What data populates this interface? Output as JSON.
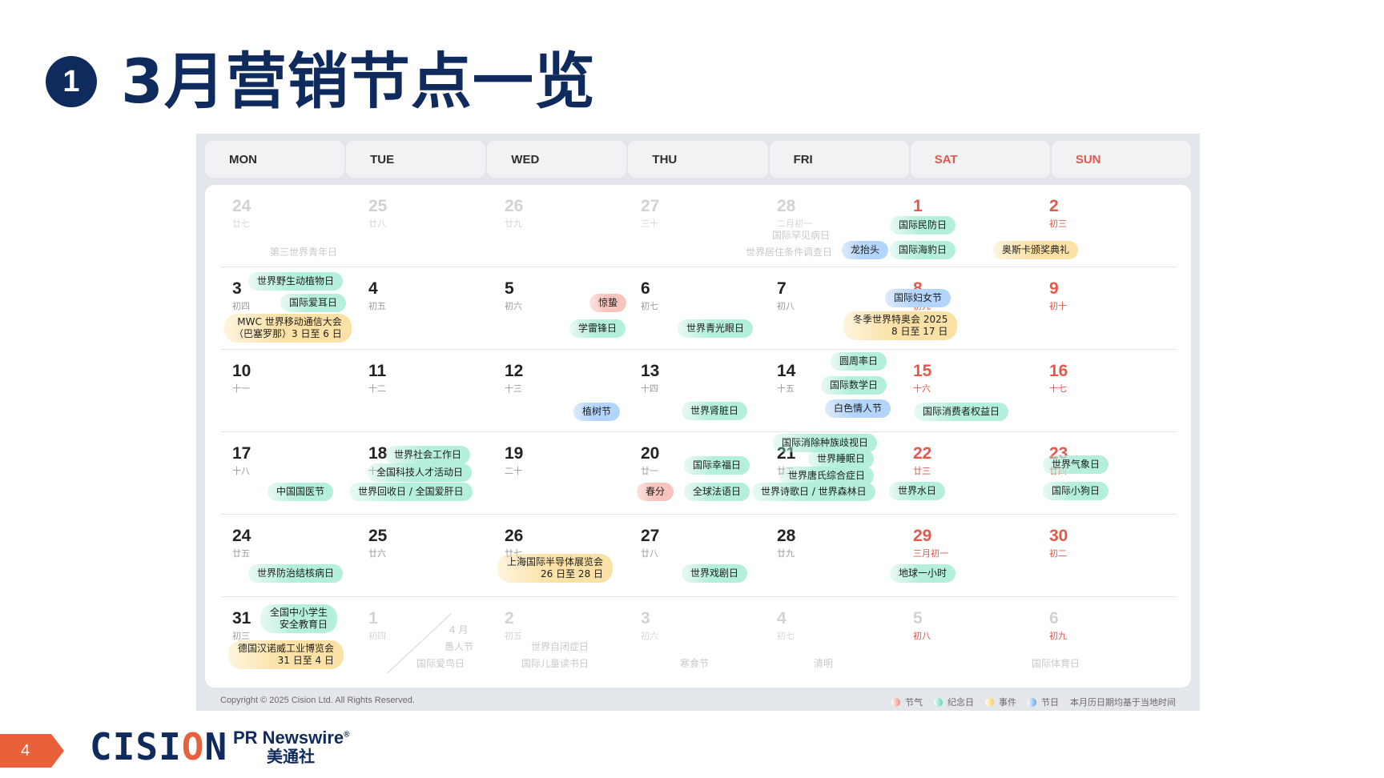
{
  "title": {
    "number": "1",
    "text": "3月营销节点一览"
  },
  "weekdays": [
    "MON",
    "TUE",
    "WED",
    "THU",
    "FRI",
    "SAT",
    "SUN"
  ],
  "weeks": [
    {
      "days": [
        {
          "num": "24",
          "lunar": "廿七"
        },
        {
          "num": "25",
          "lunar": "廿八"
        },
        {
          "num": "26",
          "lunar": "廿九"
        },
        {
          "num": "27",
          "lunar": "三十"
        },
        {
          "num": "28",
          "lunar": "二月初一"
        },
        {
          "num": "1",
          "lunar": "初二"
        },
        {
          "num": "2",
          "lunar": "初三"
        }
      ],
      "ghosts": [
        "第三世界青年日",
        "国际罕见病日",
        "世界居住条件调查日"
      ],
      "tags": [
        "国际民防日",
        "龙抬头",
        "国际海豹日",
        "奥斯卡颁奖典礼"
      ]
    },
    {
      "days": [
        {
          "num": "3",
          "lunar": "初四"
        },
        {
          "num": "4",
          "lunar": "初五"
        },
        {
          "num": "5",
          "lunar": "初六"
        },
        {
          "num": "6",
          "lunar": "初七"
        },
        {
          "num": "7",
          "lunar": "初八"
        },
        {
          "num": "8",
          "lunar": "初九"
        },
        {
          "num": "9",
          "lunar": "初十"
        }
      ],
      "tags": [
        "世界野生动植物日",
        "国际爱耳日",
        "MWC 世界移动通信大会",
        "（巴塞罗那）3 日至 6 日",
        "惊蛰",
        "学雷锋日",
        "世界青光眼日",
        "国际妇女节",
        "冬季世界特奥会 2025",
        "8 日至 17 日"
      ]
    },
    {
      "days": [
        {
          "num": "10",
          "lunar": "十一"
        },
        {
          "num": "11",
          "lunar": "十二"
        },
        {
          "num": "12",
          "lunar": "十三"
        },
        {
          "num": "13",
          "lunar": "十四"
        },
        {
          "num": "14",
          "lunar": "十五"
        },
        {
          "num": "15",
          "lunar": "十六"
        },
        {
          "num": "16",
          "lunar": "十七"
        }
      ],
      "tags": [
        "植树节",
        "世界肾脏日",
        "圆周率日",
        "国际数学日",
        "白色情人节",
        "国际消费者权益日"
      ]
    },
    {
      "days": [
        {
          "num": "17",
          "lunar": "十八"
        },
        {
          "num": "18",
          "lunar": "十九"
        },
        {
          "num": "19",
          "lunar": "二十"
        },
        {
          "num": "20",
          "lunar": "廿一"
        },
        {
          "num": "21",
          "lunar": "廿二"
        },
        {
          "num": "22",
          "lunar": "廿三"
        },
        {
          "num": "23",
          "lunar": "廿四"
        }
      ],
      "tags": [
        "中国国医节",
        "世界社会工作日",
        "全国科技人才活动日",
        "世界回收日 / 全国爱肝日",
        "国际幸福日",
        "春分",
        "全球法语日",
        "国际消除种族歧视日",
        "世界睡眠日",
        "世界唐氏综合症日",
        "世界诗歌日 / 世界森林日",
        "世界水日",
        "世界气象日",
        "国际小狗日"
      ]
    },
    {
      "days": [
        {
          "num": "24",
          "lunar": "廿五"
        },
        {
          "num": "25",
          "lunar": "廿六"
        },
        {
          "num": "26",
          "lunar": "廿七"
        },
        {
          "num": "27",
          "lunar": "廿八"
        },
        {
          "num": "28",
          "lunar": "廿九"
        },
        {
          "num": "29",
          "lunar": "三月初一"
        },
        {
          "num": "30",
          "lunar": "初二"
        }
      ],
      "tags": [
        "世界防治结核病日",
        "上海国际半导体展览会",
        "26 日至 28 日",
        "世界戏剧日",
        "地球一小时"
      ]
    },
    {
      "days": [
        {
          "num": "31",
          "lunar": "初三"
        },
        {
          "num": "1",
          "lunar": "初四"
        },
        {
          "num": "2",
          "lunar": "初五"
        },
        {
          "num": "3",
          "lunar": "初六"
        },
        {
          "num": "4",
          "lunar": "初七"
        },
        {
          "num": "5",
          "lunar": "初八"
        },
        {
          "num": "6",
          "lunar": "初九"
        }
      ],
      "tags": [
        "全国中小学生",
        "安全教育日",
        "德国汉诺威工业博览会",
        "31 日至 4 日"
      ],
      "ghosts": [
        "4 月",
        "愚人节",
        "国际爱鸟日",
        "世界自闭症日",
        "国际儿童读书日",
        "寒食节",
        "清明",
        "国际体育日"
      ]
    }
  ],
  "footer": {
    "copyright": "Copyright © 2025 Cision Ltd. All Rights Reserved.",
    "legend": [
      {
        "label": "节气",
        "color": "#f08d80"
      },
      {
        "label": "纪念日",
        "color": "#63d6b3"
      },
      {
        "label": "事件",
        "color": "#f5c965"
      },
      {
        "label": "节日",
        "color": "#6aa4ee"
      }
    ],
    "note": "本月历日期均基于当地时间"
  },
  "brand": {
    "page": "4",
    "cision_a": "CISI",
    "cision_b": "O",
    "cision_c": "N",
    "prn_en": "PR Newswire",
    "prn_cn": "美通社",
    "reg": "®"
  }
}
